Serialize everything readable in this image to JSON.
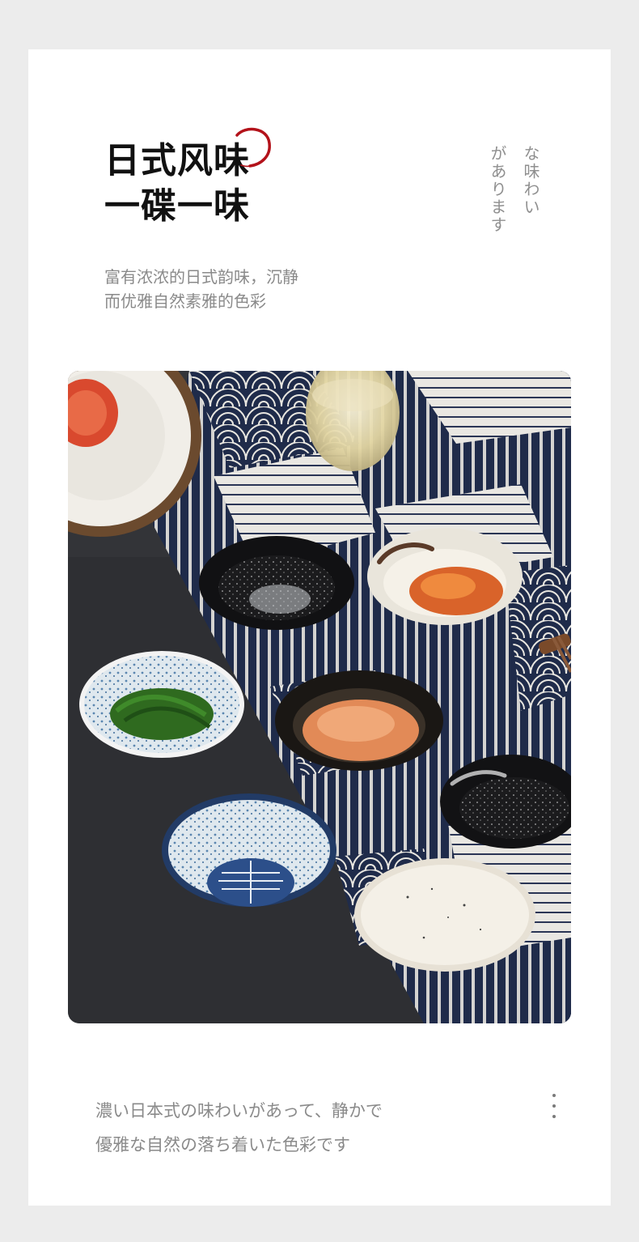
{
  "header": {
    "title_line1": "日式风味",
    "title_line2": "一碟一味",
    "vertical_col1": "な味わい",
    "vertical_col2": "があります"
  },
  "intro": {
    "line1": "富有浓浓的日式韵味，沉静",
    "line2": "而优雅自然素雅的色彩"
  },
  "footer": {
    "line1": "濃い日本式の味わいがあって、静かで",
    "line2": "優雅な自然の落ち着いた色彩です"
  },
  "icons": {
    "brush_circle": "brush-circle-icon",
    "more": "more-vertical-icon"
  },
  "colors": {
    "accent_red": "#b3121a",
    "indigo": "#1f2b4a",
    "text_gray": "#8a8a8a"
  }
}
